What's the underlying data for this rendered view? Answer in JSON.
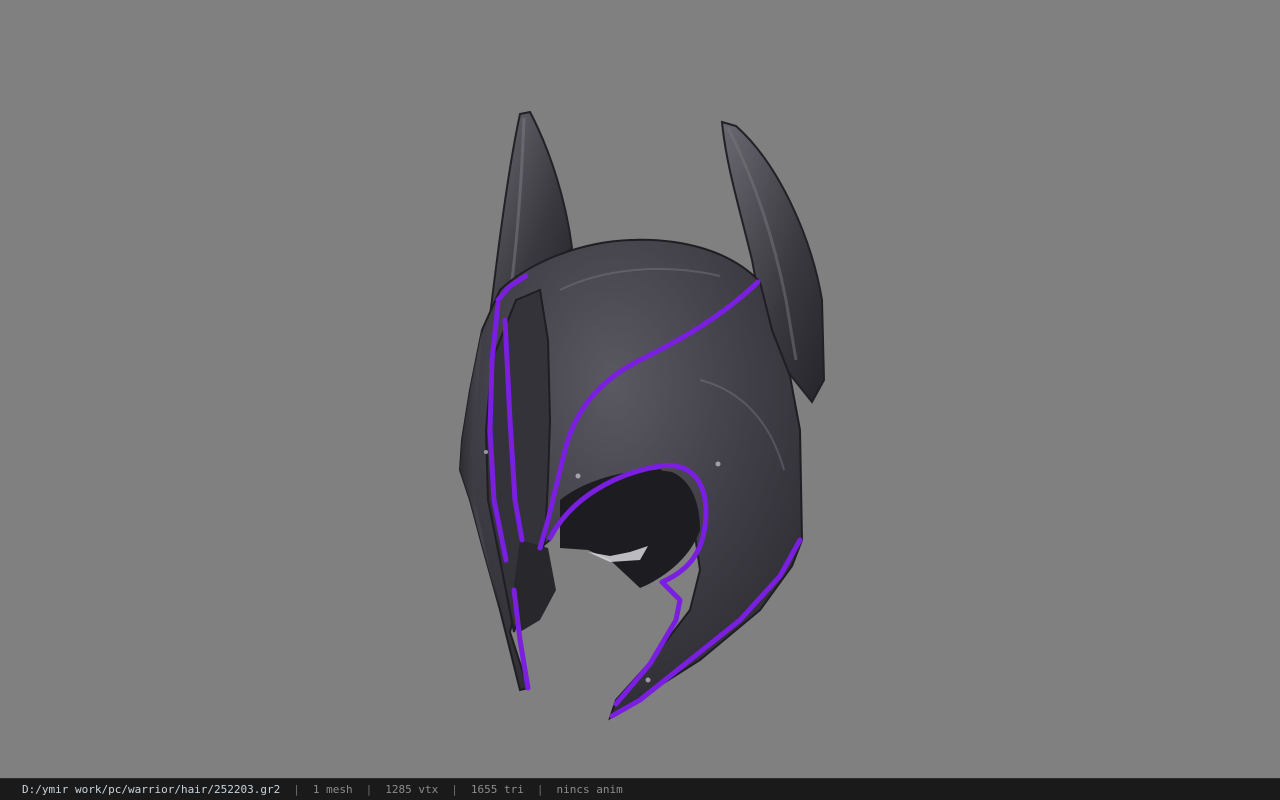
{
  "viewer": {
    "background_color": "#808080",
    "model_icon": "helmet-model",
    "colors": {
      "metal": "#3b3a41",
      "trim": "#7a1fe0"
    }
  },
  "status_bar": {
    "file_path": "D:/ymir work/pc/warrior/hair/252203.gr2",
    "separator": "|",
    "mesh_count": "1 mesh",
    "vertex_count": "1285 vtx",
    "triangle_count": "1655 tri",
    "anim_status": "nincs anim"
  }
}
